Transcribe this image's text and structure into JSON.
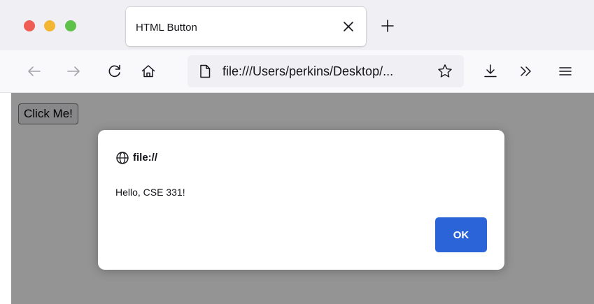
{
  "window": {
    "traffic_lights": {
      "close_color": "#ee5e55",
      "minimize_color": "#f2b632",
      "zoom_color": "#5ec24a"
    }
  },
  "tab": {
    "title": "HTML Button",
    "close_icon": "close-icon",
    "new_tab_icon": "plus-icon"
  },
  "toolbar": {
    "back_icon": "arrow-left-icon",
    "forward_icon": "arrow-right-icon",
    "reload_icon": "reload-icon",
    "home_icon": "home-icon",
    "url": "file:///Users/perkins/Desktop/...",
    "page_icon": "page-icon",
    "bookmark_icon": "star-icon",
    "download_icon": "download-icon",
    "overflow_icon": "double-chevron-right-icon",
    "menu_icon": "hamburger-menu-icon"
  },
  "page": {
    "button_label": "Click Me!"
  },
  "dialog": {
    "origin": "file://",
    "origin_icon": "globe-icon",
    "message": "Hello, CSE 331!",
    "ok_label": "OK",
    "accent_color": "#2b63d9"
  }
}
